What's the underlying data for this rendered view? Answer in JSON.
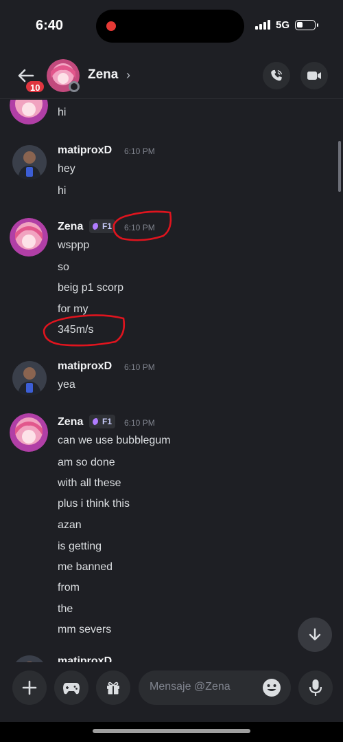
{
  "status_bar": {
    "time": "6:40",
    "network": "5G"
  },
  "header": {
    "back_badge": "10",
    "contact_name": "Zena",
    "chevron": "›"
  },
  "messages": {
    "top_partial_line": "hi",
    "group1": {
      "author": "matiproxD",
      "time": "6:10 PM",
      "lines": [
        "hey",
        "hi"
      ]
    },
    "group2": {
      "author": "Zena",
      "tag": "F1",
      "time": "6:10 PM",
      "lines": [
        "wsppp",
        "so",
        "beig p1 scorp",
        "for my",
        "345m/s"
      ]
    },
    "group3": {
      "author": "matiproxD",
      "time": "6:10 PM",
      "lines": [
        "yea"
      ]
    },
    "group4": {
      "author": "Zena",
      "tag": "F1",
      "time": "6:10 PM",
      "lines": [
        "can we use bubblegum",
        "am so done",
        "with all these",
        "plus i think this",
        "azan",
        "is getting",
        "me banned",
        "from",
        "the",
        "mm severs"
      ]
    },
    "peek_author": "matiproxD"
  },
  "composer": {
    "placeholder": "Mensaje @Zena"
  },
  "colors": {
    "background": "#1e1f24",
    "annotation": "#e0141e",
    "badge": "#e0353f",
    "nitro": "#b07cff"
  }
}
